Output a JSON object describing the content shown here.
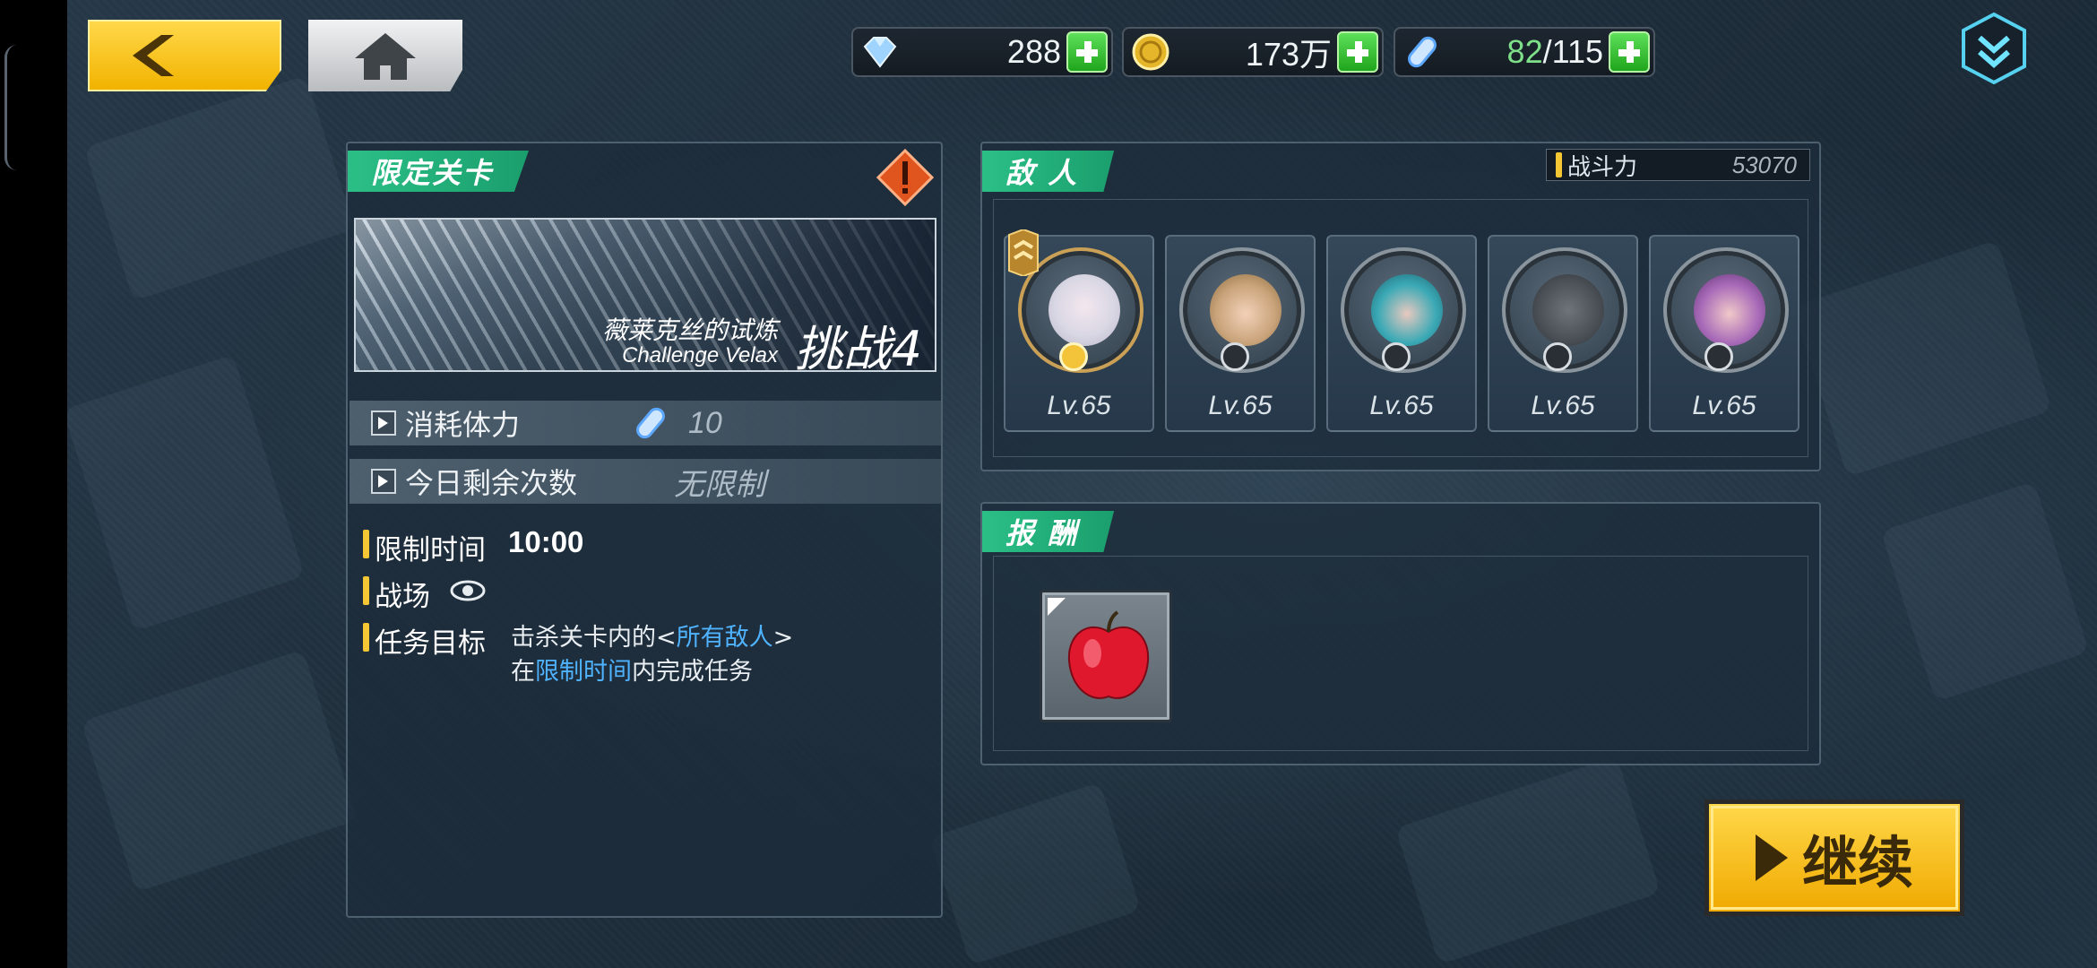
{
  "resources": {
    "gems": "288",
    "gold": "173万",
    "stamina_current": "82",
    "stamina_max": "/115"
  },
  "stage": {
    "tag": "限定关卡",
    "banner_title": "薇莱克丝的试炼",
    "banner_subtitle": "Challenge Velax",
    "banner_level": "挑战4",
    "cost_label": "消耗体力",
    "cost_value": "10",
    "remaining_label": "今日剩余次数",
    "remaining_value": "无限制",
    "time_label": "限制时间",
    "time_value": "10:00",
    "field_label": "战场",
    "objective_label": "任务目标",
    "objective_line1_a": "击杀关卡内的<",
    "objective_line1_highlight": "所有敌人",
    "objective_line1_b": ">",
    "objective_line2_a": "在",
    "objective_line2_highlight": "限制时间",
    "objective_line2_b": "内完成任务"
  },
  "enemies": {
    "tag": "敌 人",
    "power_label": "战斗力",
    "power_value": "53070",
    "list": [
      {
        "level": "Lv.65"
      },
      {
        "level": "Lv.65"
      },
      {
        "level": "Lv.65"
      },
      {
        "level": "Lv.65"
      },
      {
        "level": "Lv.65"
      }
    ]
  },
  "rewards": {
    "tag": "报 酬",
    "items": [
      "apple-icon"
    ]
  },
  "actions": {
    "continue_label": "继续"
  },
  "colors": {
    "accent_green": "#2bbf86",
    "accent_yellow": "#f6c734",
    "highlight_blue": "#4fb3ff"
  }
}
